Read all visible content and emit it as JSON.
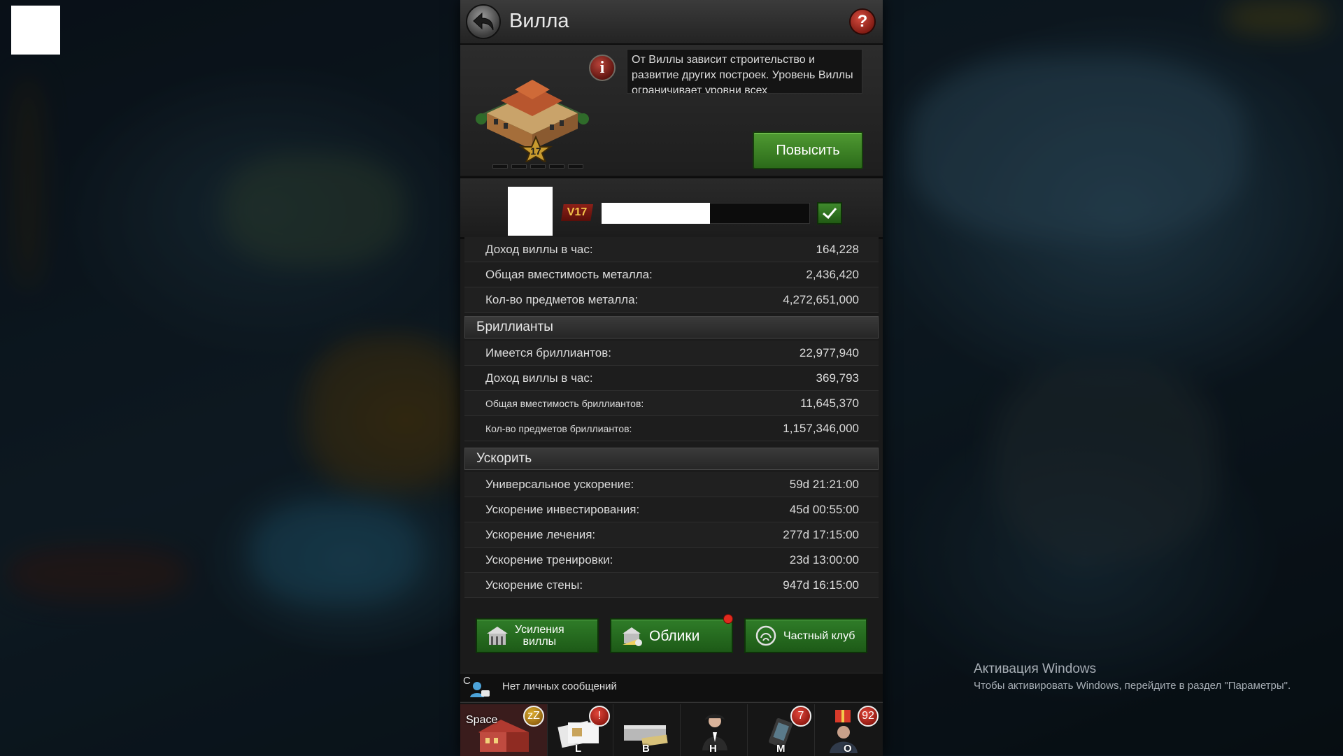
{
  "window": {
    "title": "Вилла"
  },
  "villa": {
    "description": "От Виллы зависит строительство и развитие других построек. Уровень Виллы ограничивает уровни всех",
    "level_badge": "17",
    "upgrade_label": "Повысить",
    "vip_label": "V17"
  },
  "metal_rows": [
    {
      "label": "Доход виллы в час:",
      "value": "164,228"
    },
    {
      "label": "Общая вместимость металла:",
      "value": "2,436,420"
    },
    {
      "label": "Кол-во предметов металла:",
      "value": "4,272,651,000"
    }
  ],
  "diamonds": {
    "header": "Бриллианты",
    "rows": [
      {
        "label": "Имеется бриллиантов:",
        "value": "22,977,940"
      },
      {
        "label": "Доход виллы в час:",
        "value": "369,793"
      },
      {
        "label": "Общая вместимость бриллиантов:",
        "value": "11,645,370"
      },
      {
        "label": "Кол-во предметов бриллиантов:",
        "value": "1,157,346,000"
      }
    ]
  },
  "speedups": {
    "header": "Ускорить",
    "rows": [
      {
        "label": "Универсальное ускорение:",
        "value": "59d 21:21:00"
      },
      {
        "label": "Ускорение инвестирования:",
        "value": "45d 00:55:00"
      },
      {
        "label": "Ускорение лечения:",
        "value": "277d 17:15:00"
      },
      {
        "label": "Ускорение тренировки:",
        "value": "23d 13:00:00"
      },
      {
        "label": "Ускорение стены:",
        "value": "947d 16:15:00"
      }
    ]
  },
  "buttons": {
    "boosts_line1": "Усиления",
    "boosts_line2": "виллы",
    "skins": "Облики",
    "club": "Частный клуб"
  },
  "messages": {
    "letter": "C",
    "text": "Нет личных сообщений"
  },
  "tabs": {
    "space": "Space",
    "zz": "zZ",
    "l": "L",
    "b": "B",
    "h": "H",
    "m": "M",
    "o": "O",
    "m_badge": "7",
    "o_badge": "92",
    "l_badge": "!"
  },
  "watermark": {
    "line1": "Активация Windows",
    "line2": "Чтобы активировать Windows, перейдите в раздел \"Параметры\"."
  },
  "colors": {
    "accent_green": "#2f7c28",
    "alert_red": "#e02a1e",
    "panel_bg": "#1b1b1b"
  }
}
